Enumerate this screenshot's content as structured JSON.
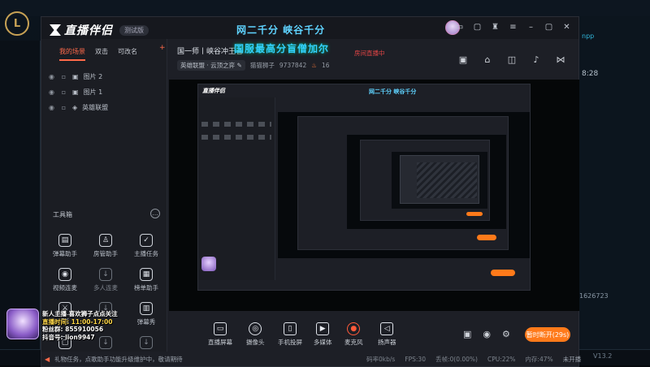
{
  "background": {
    "game_logo": "L",
    "time": "8:28",
    "number": "1626723",
    "version": "V13.2",
    "cyan_text": "npp"
  },
  "app": {
    "logo_text": "直播伴侣",
    "logo_badge": "测试版",
    "window_title": "网二千分 峡谷千分",
    "window_controls": [
      "avatar",
      "screen-icon",
      "chat-icon",
      "shirt-icon",
      "menu-icon",
      "minimize-icon",
      "maximize-icon",
      "close-icon"
    ]
  },
  "sidebar": {
    "tabs": [
      {
        "label": "我的场景",
        "active": true
      },
      {
        "label": "双击",
        "active": false
      },
      {
        "label": "可改名",
        "active": false
      }
    ],
    "scenes": [
      {
        "label": "图片 2",
        "type": "image"
      },
      {
        "label": "图片 1",
        "type": "image"
      },
      {
        "label": "英雄联盟",
        "type": "game"
      }
    ],
    "tools_label": "工具箱",
    "tools": [
      {
        "label": "弹幕助手",
        "icon": "danmaku-icon",
        "enabled": true,
        "glyph": "▤"
      },
      {
        "label": "房管助手",
        "icon": "admin-icon",
        "enabled": true,
        "glyph": "♙"
      },
      {
        "label": "主播任务",
        "icon": "task-icon",
        "enabled": true,
        "glyph": "✓"
      },
      {
        "label": "视频连麦",
        "icon": "video-link-icon",
        "enabled": true,
        "glyph": "◉"
      },
      {
        "label": "多人连麦",
        "icon": "multi-link-icon",
        "enabled": false,
        "glyph": "↓"
      },
      {
        "label": "榜单助手",
        "icon": "rank-icon",
        "enabled": true,
        "glyph": "▦"
      },
      {
        "label": "PK",
        "icon": "pk-icon",
        "enabled": true,
        "glyph": "⚔"
      },
      {
        "label": "",
        "icon": "download-icon",
        "enabled": false,
        "glyph": "↓"
      },
      {
        "label": "弹幕秀",
        "icon": "danmaku-show-icon",
        "enabled": true,
        "glyph": "▥"
      },
      {
        "label": "",
        "icon": "doc-icon",
        "enabled": true,
        "glyph": "▢"
      },
      {
        "label": "",
        "icon": "download2-icon",
        "enabled": false,
        "glyph": "↓"
      },
      {
        "label": "",
        "icon": "download3-icon",
        "enabled": false,
        "glyph": "↓"
      }
    ]
  },
  "room": {
    "title_prefix": "国一师丨峡谷冲王者",
    "title_highlight": "国服最高分盲僧加尔",
    "status_red": "房间直播中",
    "category": "英雄联盟 · 云顶之弈",
    "streamer_name": "猫猫狮子",
    "room_id": "9737842",
    "heat": "16"
  },
  "header_icons": [
    "gift-box-icon",
    "lock-icon",
    "share-screen-icon",
    "bell-icon",
    "share-icon"
  ],
  "bottom_tools": [
    {
      "label": "直播屏幕",
      "icon": "screen-cast-icon",
      "glyph": "▭"
    },
    {
      "label": "摄像头",
      "icon": "camera-icon",
      "glyph": "◎"
    },
    {
      "label": "手机投屏",
      "icon": "phone-cast-icon",
      "glyph": "▯"
    },
    {
      "label": "多媒体",
      "icon": "media-icon",
      "glyph": "▶"
    },
    {
      "label": "麦克风",
      "icon": "microphone-icon",
      "glyph": "●"
    },
    {
      "label": "扬声器",
      "icon": "speaker-icon",
      "glyph": "◁"
    }
  ],
  "right_controls": [
    "record-icon",
    "eye-icon",
    "settings-icon"
  ],
  "live_button": "暂时断开(29s)",
  "notice": "礼物任务，点歌助手功能升级维护中，敬请期待",
  "stats": {
    "bitrate": "码率0kb/s",
    "fps": "FPS:30",
    "drop": "丢帧:0(0.00%)",
    "cpu": "CPU:22%",
    "mem": "内存:47%",
    "status": "未开播"
  },
  "overlay": {
    "line1": "新人主播  喜欢狮子点点关注",
    "line2": "直播时间:  11:00-17:00",
    "line3": "粉丝群:  855910056",
    "line4": "抖音号:  lion9947"
  },
  "colors": {
    "accent": "#ff6a4a",
    "live_button": "#ff7a1a",
    "title_cyan": "#5fd3ff",
    "room_highlight": "#33cfff"
  }
}
